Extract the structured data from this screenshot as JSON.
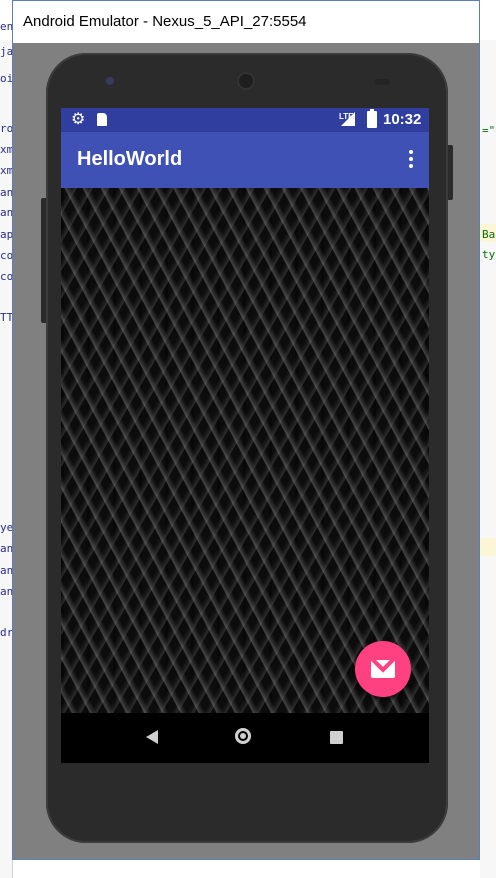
{
  "window": {
    "title": "Android Emulator - Nexus_5_API_27:5554"
  },
  "background_ide": {
    "left_fragments": [
      "en",
      "ja",
      "oi",
      "ro",
      "xm",
      "xm",
      "an",
      "an",
      "ap",
      "co",
      "co",
      "TT",
      "ye",
      "an",
      "an",
      "an",
      "dr"
    ],
    "right_fragments": [
      "=\"",
      "Ba",
      "ty"
    ]
  },
  "status_bar": {
    "settings_icon": "gear-icon",
    "sd_card_icon": "sd-card-icon",
    "network_label": "LTE",
    "time": "10:32",
    "color": "#303f9f"
  },
  "app_bar": {
    "title": "HelloWorld",
    "overflow_icon": "more-vert-icon",
    "color": "#3f51b5"
  },
  "content": {
    "background": "woven-wicker-texture"
  },
  "fab": {
    "icon": "mail-icon",
    "color": "#ff4081"
  },
  "nav_bar": {
    "back_icon": "back-triangle-icon",
    "home_icon": "home-circle-icon",
    "recents_icon": "recents-square-icon"
  }
}
